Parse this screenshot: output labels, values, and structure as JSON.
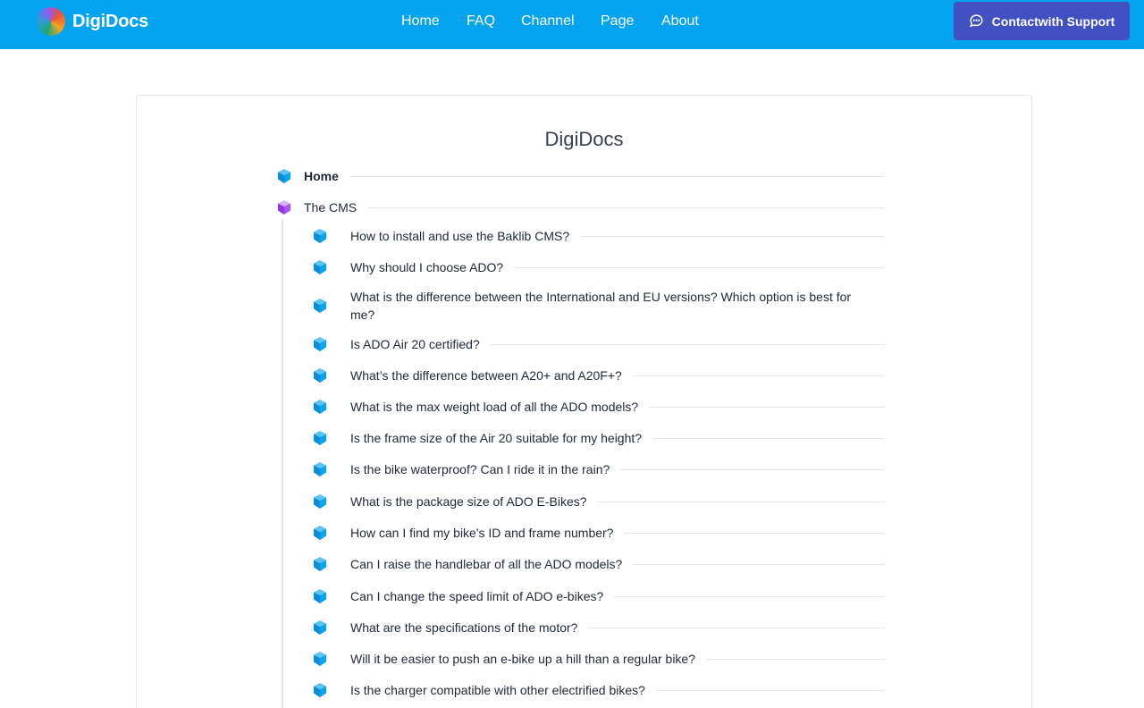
{
  "header": {
    "brand": "DigiDocs",
    "nav": [
      "Home",
      "FAQ",
      "Channel",
      "Page",
      "About"
    ],
    "support_label": "Contactwith Support"
  },
  "colors": {
    "header_bg": "#03a3ef",
    "support_bg": "#4151c2",
    "icon_blue": "#0aa0e8",
    "icon_purple": "#a855f7"
  },
  "main": {
    "title": "DigiDocs",
    "tree": {
      "home": "Home",
      "section": "The CMS",
      "children": [
        "How to install and use the Baklib CMS?",
        "Why should I choose ADO?",
        "What is the difference between the International and EU versions? Which option is best for me?",
        "Is ADO Air 20 certified?",
        "What’s the difference between A20+ and A20F+?",
        "What is the max weight load of all the ADO models?",
        "Is the frame size of the Air 20 suitable for my height?",
        "Is the bike waterproof? Can I ride it in the rain?",
        "What is the package size of ADO E-Bikes?",
        "How can I find my bike's ID and frame number?",
        "Can I raise the handlebar of all the ADO models?",
        "Can I change the speed limit of ADO e-bikes?",
        "What are the specifications of the motor?",
        "Will it be easier to push an e-bike up a hill than a regular bike?",
        "Is the charger compatible with other electrified bikes?"
      ]
    }
  }
}
